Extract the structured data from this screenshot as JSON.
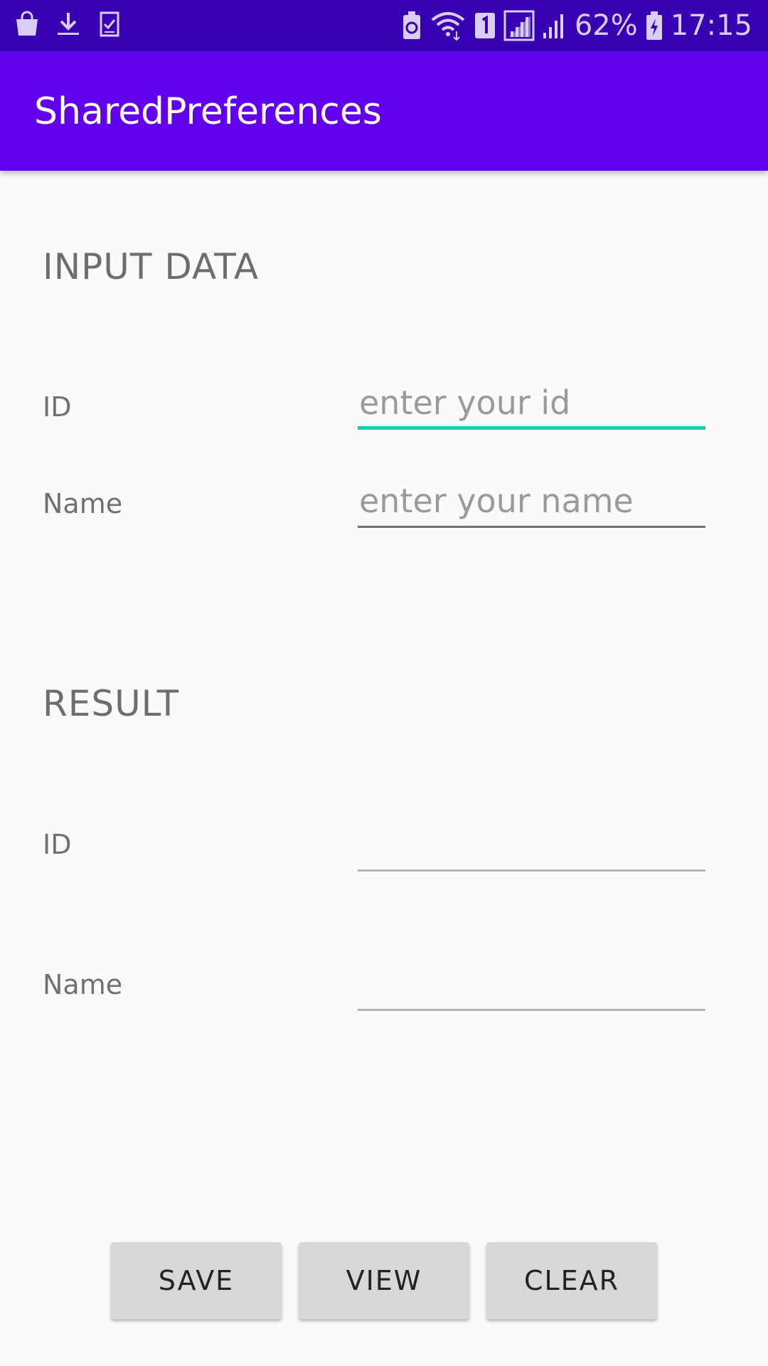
{
  "status_bar": {
    "icons_left": [
      "shopping-bag-icon",
      "download-icon",
      "clipboard-check-icon"
    ],
    "icons_right": [
      "battery-saver-icon",
      "wifi-icon",
      "sim-1-icon",
      "signal-icon",
      "signal-icon"
    ],
    "battery_percent": "62%",
    "time": "17:15"
  },
  "app_bar": {
    "title": "SharedPreferences"
  },
  "input_section": {
    "heading": "INPUT DATA",
    "id_label": "ID",
    "id_placeholder": "enter your id",
    "id_value": "",
    "name_label": "Name",
    "name_placeholder": "enter your name",
    "name_value": ""
  },
  "result_section": {
    "heading": "RESULT",
    "id_label": "ID",
    "id_value": "",
    "name_label": "Name",
    "name_value": ""
  },
  "buttons": {
    "save": "SAVE",
    "view": "VIEW",
    "clear": "CLEAR"
  },
  "colors": {
    "status_bar": "#3700b3",
    "app_bar": "#6200ee",
    "focus_accent": "#18cabb",
    "background": "#fafafa",
    "button": "#d7d7d7"
  }
}
